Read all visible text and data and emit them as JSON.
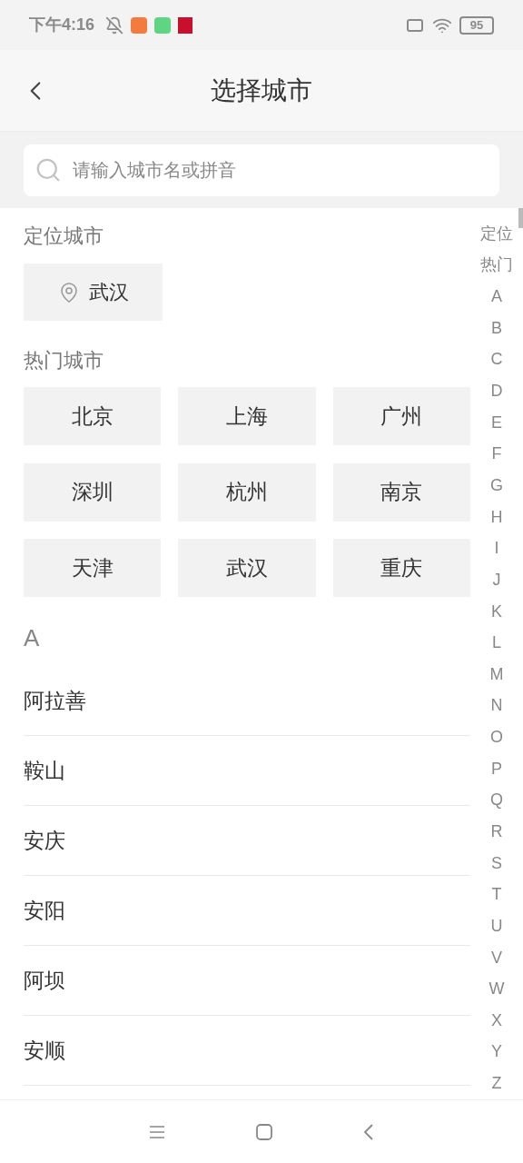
{
  "status_bar": {
    "time": "下午4:16",
    "battery": "95"
  },
  "header": {
    "title": "选择城市"
  },
  "search": {
    "placeholder": "请输入城市名或拼音"
  },
  "location": {
    "label": "定位城市",
    "city": "武汉"
  },
  "hot": {
    "label": "热门城市",
    "cities": [
      "北京",
      "上海",
      "广州",
      "深圳",
      "杭州",
      "南京",
      "天津",
      "武汉",
      "重庆"
    ]
  },
  "sections": [
    {
      "letter": "A",
      "cities": [
        "阿拉善",
        "鞍山",
        "安庆",
        "安阳",
        "阿坝",
        "安顺"
      ]
    }
  ],
  "index": [
    "定位",
    "热门",
    "A",
    "B",
    "C",
    "D",
    "E",
    "F",
    "G",
    "H",
    "I",
    "J",
    "K",
    "L",
    "M",
    "N",
    "O",
    "P",
    "Q",
    "R",
    "S",
    "T",
    "U",
    "V",
    "W",
    "X",
    "Y",
    "Z"
  ]
}
